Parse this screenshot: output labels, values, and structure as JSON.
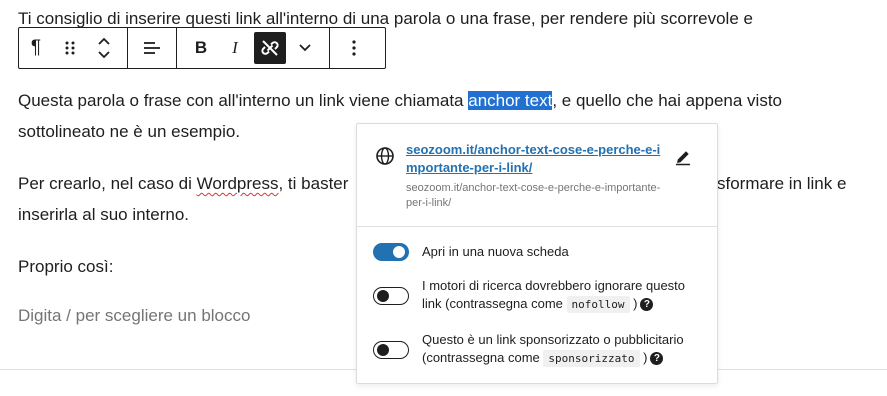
{
  "paragraphs": {
    "p1": "Ti consiglio di inserire questi link all'interno di una parola o una frase, per rendere più scorrevole e",
    "p2_before": "Questa parola o frase con all'interno un link viene chiamata ",
    "p2_highlight": "anchor text",
    "p2_after": ", e quello che hai appena visto",
    "p2_line2": "sottolineato ne è un esempio.",
    "p3_start": "Per crearlo, nel caso di ",
    "p3_wordpress": "Wordpress",
    "p3_mid": ", ti baster",
    "p3_end": "sformare in link e",
    "p3_line2": "inserirla al suo interno.",
    "p4": "Proprio così:",
    "placeholder": "Digita / per scegliere un blocco"
  },
  "toolbar": {
    "paragraph_icon": "¶",
    "drag_icon": "drag-handle-icon",
    "move_icon": "move-up-down-icon",
    "align_icon": "align-left-icon",
    "bold_label": "B",
    "italic_label": "I",
    "unlink_icon": "link-off-icon",
    "more_formats_icon": "chevron-down-icon",
    "options_icon": "more-vertical-icon"
  },
  "link_popover": {
    "url_display": "seozoom.it/anchor-text-cose-e-perche-e-importante-per-i-link/",
    "url_full": "seozoom.it/anchor-text-cose-e-perche-e-importante-per-i-link/",
    "options": [
      {
        "label": "Apri in una nuova scheda",
        "on": true
      },
      {
        "label_before": "I motori di ricerca dovrebbero ignorare questo link (contrassegna come ",
        "code": "nofollow",
        "label_after": " )",
        "on": false
      },
      {
        "label_before": "Questo è un link sponsorizzato o pubblicitario (contrassegna come ",
        "code": "sponsorizzato",
        "label_after": " )",
        "on": false
      }
    ],
    "help_glyph": "?"
  },
  "colors": {
    "accent": "#2271b1",
    "highlight": "#2271d1",
    "text": "#1e1e1e",
    "muted": "#757575"
  }
}
